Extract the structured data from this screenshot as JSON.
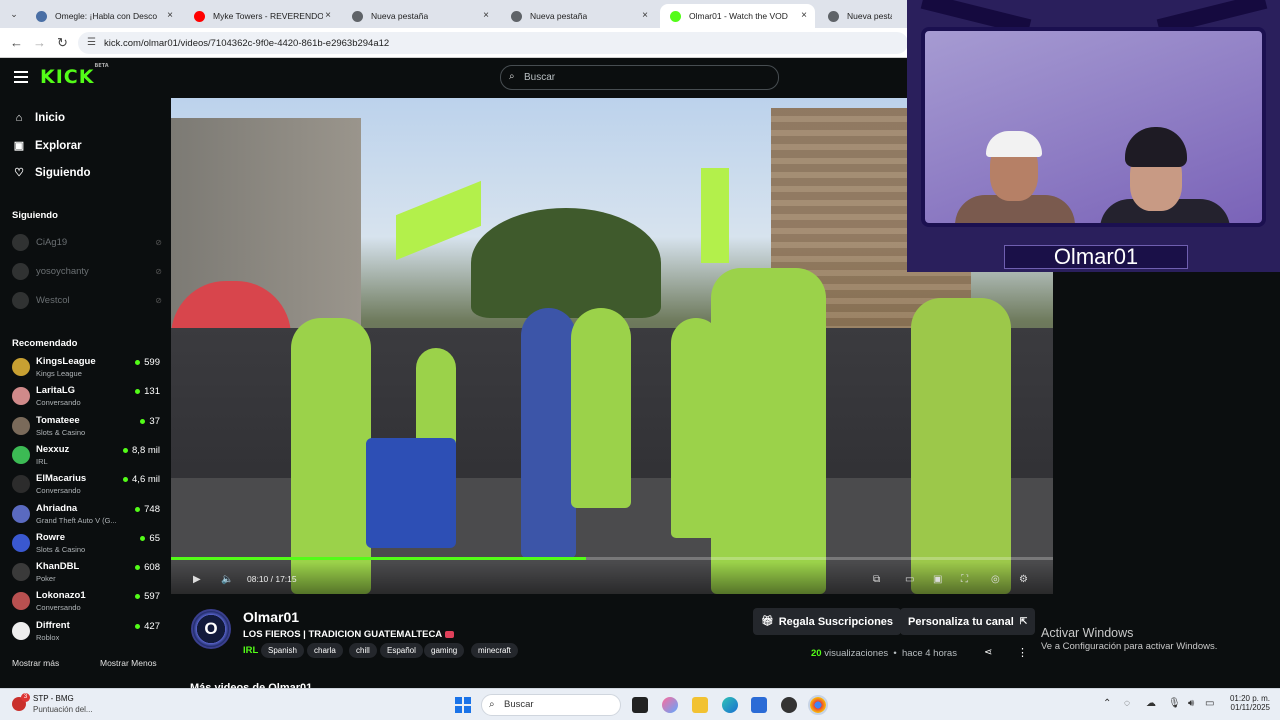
{
  "browser": {
    "tabs": [
      {
        "title": "Omegle: ¡Habla con Desco",
        "favicon_color": "#4a6fa5",
        "icon": "omegle-favicon-icon"
      },
      {
        "title": "Myke Towers - REVERENDO (Vi",
        "favicon_color": "#ff0000",
        "icon": "youtube-favicon-icon"
      },
      {
        "title": "Nueva pestaña",
        "favicon_color": "#5f6368",
        "icon": "chrome-favicon-icon"
      },
      {
        "title": "Nueva pestaña",
        "favicon_color": "#5f6368",
        "icon": "chrome-favicon-icon"
      },
      {
        "title": "Olmar01 - Watch the VOD",
        "favicon_color": "#53fc18",
        "icon": "kick-favicon-icon"
      },
      {
        "title": "Nueva pestaña",
        "favicon_color": "#5f6368",
        "icon": "chrome-favicon-icon"
      }
    ],
    "url": "kick.com/olmar01/videos/7104362c-9f0e-4420-861b-e2963b294a12"
  },
  "header": {
    "logo": "KICK",
    "logo_badge": "BETA",
    "search_placeholder": "Buscar"
  },
  "sidebar": {
    "nav": [
      {
        "label": "Inicio",
        "icon": "home-icon"
      },
      {
        "label": "Explorar",
        "icon": "explore-icon"
      },
      {
        "label": "Siguiendo",
        "icon": "heart-icon"
      }
    ],
    "following_title": "Siguiendo",
    "following": [
      {
        "name": "CiAg19"
      },
      {
        "name": "yosoychanty"
      },
      {
        "name": "Westcol"
      }
    ],
    "recommended_title": "Recomendado",
    "recommended": [
      {
        "name": "KingsLeague",
        "category": "Kings League",
        "viewers": "599",
        "color": "#c8a032"
      },
      {
        "name": "LaritaLG",
        "category": "Conversando",
        "viewers": "131",
        "color": "#d08a8a"
      },
      {
        "name": "Tomateee",
        "category": "Slots & Casino",
        "viewers": "37",
        "color": "#7a6a5a"
      },
      {
        "name": "Nexxuz",
        "category": "IRL",
        "viewers": "8,8 mil",
        "color": "#3cba54"
      },
      {
        "name": "ElMacarius",
        "category": "Conversando",
        "viewers": "4,6 mil",
        "color": "#2c2c2c"
      },
      {
        "name": "Ahriadna",
        "category": "Grand Theft Auto V (G...",
        "viewers": "748",
        "color": "#5a6ac0"
      },
      {
        "name": "Rowre",
        "category": "Slots & Casino",
        "viewers": "65",
        "color": "#3a58d0"
      },
      {
        "name": "KhanDBL",
        "category": "Poker",
        "viewers": "608",
        "color": "#3a3a3a"
      },
      {
        "name": "Lokonazo1",
        "category": "Conversando",
        "viewers": "597",
        "color": "#b85050"
      },
      {
        "name": "Diffrent",
        "category": "Roblox",
        "viewers": "427",
        "color": "#eeeeee"
      }
    ],
    "show_more": "Mostrar más",
    "show_less": "Mostrar Menos"
  },
  "player": {
    "time": "08:10 / 17:15",
    "progress_fraction": 0.47
  },
  "webcam": {
    "name": "Olmar01"
  },
  "channel": {
    "avatar_letter": "O",
    "name": "Olmar01",
    "title": "LOS FIEROS | TRADICION GUATEMALTECA",
    "category": "IRL",
    "tags": [
      "Spanish",
      "charla",
      "chill",
      "Español",
      "gaming",
      "minecraft"
    ],
    "gift_button": "Regala Suscripciones",
    "customize_button": "Personaliza tu canal",
    "views_count": "20",
    "views_label": "visualizaciones",
    "ago": "hace 4 horas",
    "more_videos": "Más videos de Olmar01"
  },
  "windows_watermark": {
    "line1": "Activar Windows",
    "line2": "Ve a Configuración para activar Windows."
  },
  "taskbar": {
    "app_title": "STP - BMG",
    "app_subtitle": "Puntuación del...",
    "app_badge": "3",
    "search_placeholder": "Buscar",
    "time": "01:20 p. m.",
    "date": "01/11/2025"
  },
  "colors": {
    "kick_green": "#53fc18",
    "background": "#0b0e0f"
  }
}
